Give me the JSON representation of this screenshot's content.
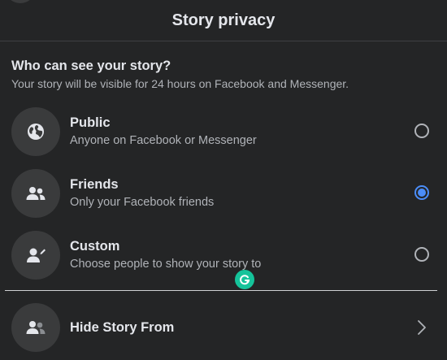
{
  "header": {
    "title": "Story privacy"
  },
  "audience": {
    "heading": "Who can see your story?",
    "subtitle": "Your story will be visible for 24 hours on Facebook and Messenger."
  },
  "options": [
    {
      "label": "Public",
      "description": "Anyone on Facebook or Messenger",
      "icon": "globe-icon",
      "selected": false
    },
    {
      "label": "Friends",
      "description": "Only your Facebook friends",
      "icon": "friends-icon",
      "selected": true
    },
    {
      "label": "Custom",
      "description": "Choose people to show your story to",
      "icon": "custom-person-icon",
      "selected": false
    }
  ],
  "hide_story": {
    "label": "Hide Story From",
    "icon": "hide-people-icon"
  },
  "colors": {
    "background": "#242526",
    "accent": "#4b8df8",
    "grammarly": "#15c39a"
  }
}
